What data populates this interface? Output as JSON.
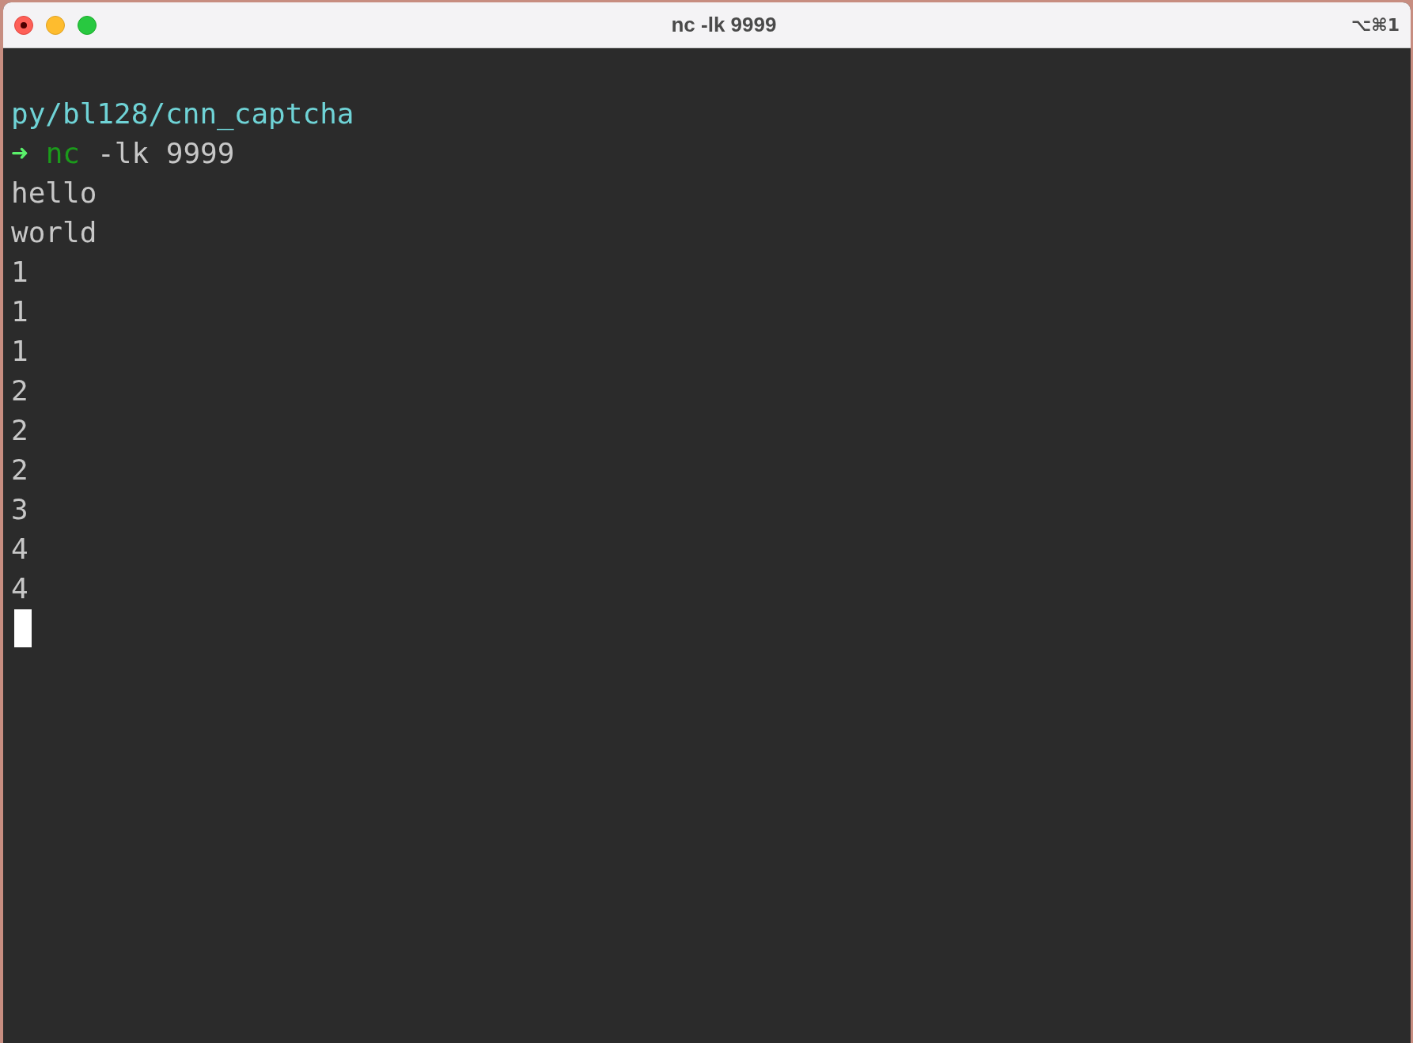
{
  "window": {
    "title": "nc -lk 9999",
    "shortcut": "⌥⌘1"
  },
  "terminal": {
    "lines": [
      {
        "kind": "path",
        "text": "py/bl128/cnn_captcha"
      },
      {
        "kind": "command",
        "prompt": "➜",
        "program": "nc",
        "args": "-lk 9999"
      },
      {
        "kind": "output",
        "text": "hello"
      },
      {
        "kind": "output",
        "text": "world"
      },
      {
        "kind": "output",
        "text": "1"
      },
      {
        "kind": "output",
        "text": "1"
      },
      {
        "kind": "output",
        "text": "1"
      },
      {
        "kind": "output",
        "text": "2"
      },
      {
        "kind": "output",
        "text": "2"
      },
      {
        "kind": "output",
        "text": "2"
      },
      {
        "kind": "output",
        "text": "3"
      },
      {
        "kind": "output",
        "text": "4"
      },
      {
        "kind": "output",
        "text": "4"
      },
      {
        "kind": "cursor"
      }
    ]
  }
}
